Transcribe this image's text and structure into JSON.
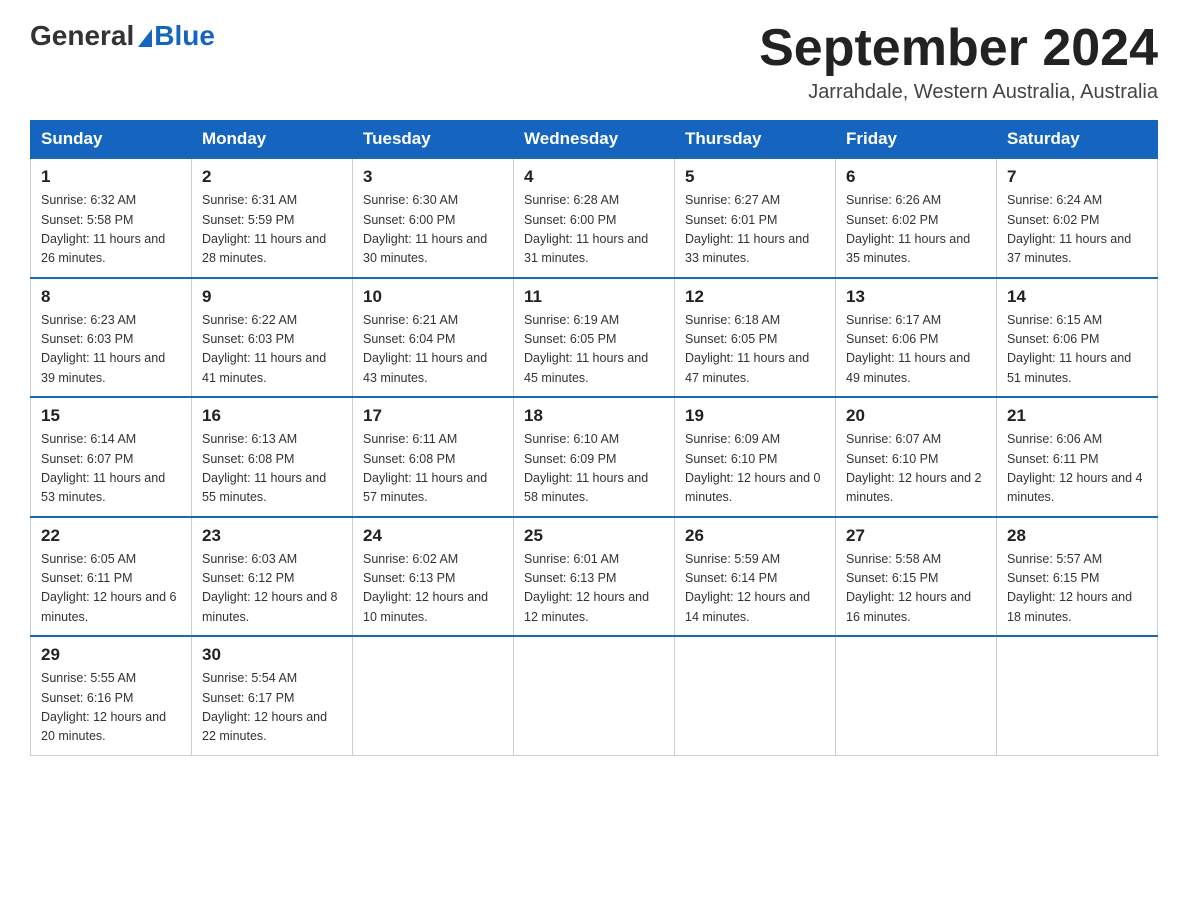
{
  "header": {
    "logo_general": "General",
    "logo_blue": "Blue",
    "month_title": "September 2024",
    "location": "Jarrahdale, Western Australia, Australia"
  },
  "days_of_week": [
    "Sunday",
    "Monday",
    "Tuesday",
    "Wednesday",
    "Thursday",
    "Friday",
    "Saturday"
  ],
  "weeks": [
    [
      {
        "day": "1",
        "sunrise": "6:32 AM",
        "sunset": "5:58 PM",
        "daylight": "11 hours and 26 minutes."
      },
      {
        "day": "2",
        "sunrise": "6:31 AM",
        "sunset": "5:59 PM",
        "daylight": "11 hours and 28 minutes."
      },
      {
        "day": "3",
        "sunrise": "6:30 AM",
        "sunset": "6:00 PM",
        "daylight": "11 hours and 30 minutes."
      },
      {
        "day": "4",
        "sunrise": "6:28 AM",
        "sunset": "6:00 PM",
        "daylight": "11 hours and 31 minutes."
      },
      {
        "day": "5",
        "sunrise": "6:27 AM",
        "sunset": "6:01 PM",
        "daylight": "11 hours and 33 minutes."
      },
      {
        "day": "6",
        "sunrise": "6:26 AM",
        "sunset": "6:02 PM",
        "daylight": "11 hours and 35 minutes."
      },
      {
        "day": "7",
        "sunrise": "6:24 AM",
        "sunset": "6:02 PM",
        "daylight": "11 hours and 37 minutes."
      }
    ],
    [
      {
        "day": "8",
        "sunrise": "6:23 AM",
        "sunset": "6:03 PM",
        "daylight": "11 hours and 39 minutes."
      },
      {
        "day": "9",
        "sunrise": "6:22 AM",
        "sunset": "6:03 PM",
        "daylight": "11 hours and 41 minutes."
      },
      {
        "day": "10",
        "sunrise": "6:21 AM",
        "sunset": "6:04 PM",
        "daylight": "11 hours and 43 minutes."
      },
      {
        "day": "11",
        "sunrise": "6:19 AM",
        "sunset": "6:05 PM",
        "daylight": "11 hours and 45 minutes."
      },
      {
        "day": "12",
        "sunrise": "6:18 AM",
        "sunset": "6:05 PM",
        "daylight": "11 hours and 47 minutes."
      },
      {
        "day": "13",
        "sunrise": "6:17 AM",
        "sunset": "6:06 PM",
        "daylight": "11 hours and 49 minutes."
      },
      {
        "day": "14",
        "sunrise": "6:15 AM",
        "sunset": "6:06 PM",
        "daylight": "11 hours and 51 minutes."
      }
    ],
    [
      {
        "day": "15",
        "sunrise": "6:14 AM",
        "sunset": "6:07 PM",
        "daylight": "11 hours and 53 minutes."
      },
      {
        "day": "16",
        "sunrise": "6:13 AM",
        "sunset": "6:08 PM",
        "daylight": "11 hours and 55 minutes."
      },
      {
        "day": "17",
        "sunrise": "6:11 AM",
        "sunset": "6:08 PM",
        "daylight": "11 hours and 57 minutes."
      },
      {
        "day": "18",
        "sunrise": "6:10 AM",
        "sunset": "6:09 PM",
        "daylight": "11 hours and 58 minutes."
      },
      {
        "day": "19",
        "sunrise": "6:09 AM",
        "sunset": "6:10 PM",
        "daylight": "12 hours and 0 minutes."
      },
      {
        "day": "20",
        "sunrise": "6:07 AM",
        "sunset": "6:10 PM",
        "daylight": "12 hours and 2 minutes."
      },
      {
        "day": "21",
        "sunrise": "6:06 AM",
        "sunset": "6:11 PM",
        "daylight": "12 hours and 4 minutes."
      }
    ],
    [
      {
        "day": "22",
        "sunrise": "6:05 AM",
        "sunset": "6:11 PM",
        "daylight": "12 hours and 6 minutes."
      },
      {
        "day": "23",
        "sunrise": "6:03 AM",
        "sunset": "6:12 PM",
        "daylight": "12 hours and 8 minutes."
      },
      {
        "day": "24",
        "sunrise": "6:02 AM",
        "sunset": "6:13 PM",
        "daylight": "12 hours and 10 minutes."
      },
      {
        "day": "25",
        "sunrise": "6:01 AM",
        "sunset": "6:13 PM",
        "daylight": "12 hours and 12 minutes."
      },
      {
        "day": "26",
        "sunrise": "5:59 AM",
        "sunset": "6:14 PM",
        "daylight": "12 hours and 14 minutes."
      },
      {
        "day": "27",
        "sunrise": "5:58 AM",
        "sunset": "6:15 PM",
        "daylight": "12 hours and 16 minutes."
      },
      {
        "day": "28",
        "sunrise": "5:57 AM",
        "sunset": "6:15 PM",
        "daylight": "12 hours and 18 minutes."
      }
    ],
    [
      {
        "day": "29",
        "sunrise": "5:55 AM",
        "sunset": "6:16 PM",
        "daylight": "12 hours and 20 minutes."
      },
      {
        "day": "30",
        "sunrise": "5:54 AM",
        "sunset": "6:17 PM",
        "daylight": "12 hours and 22 minutes."
      },
      null,
      null,
      null,
      null,
      null
    ]
  ]
}
